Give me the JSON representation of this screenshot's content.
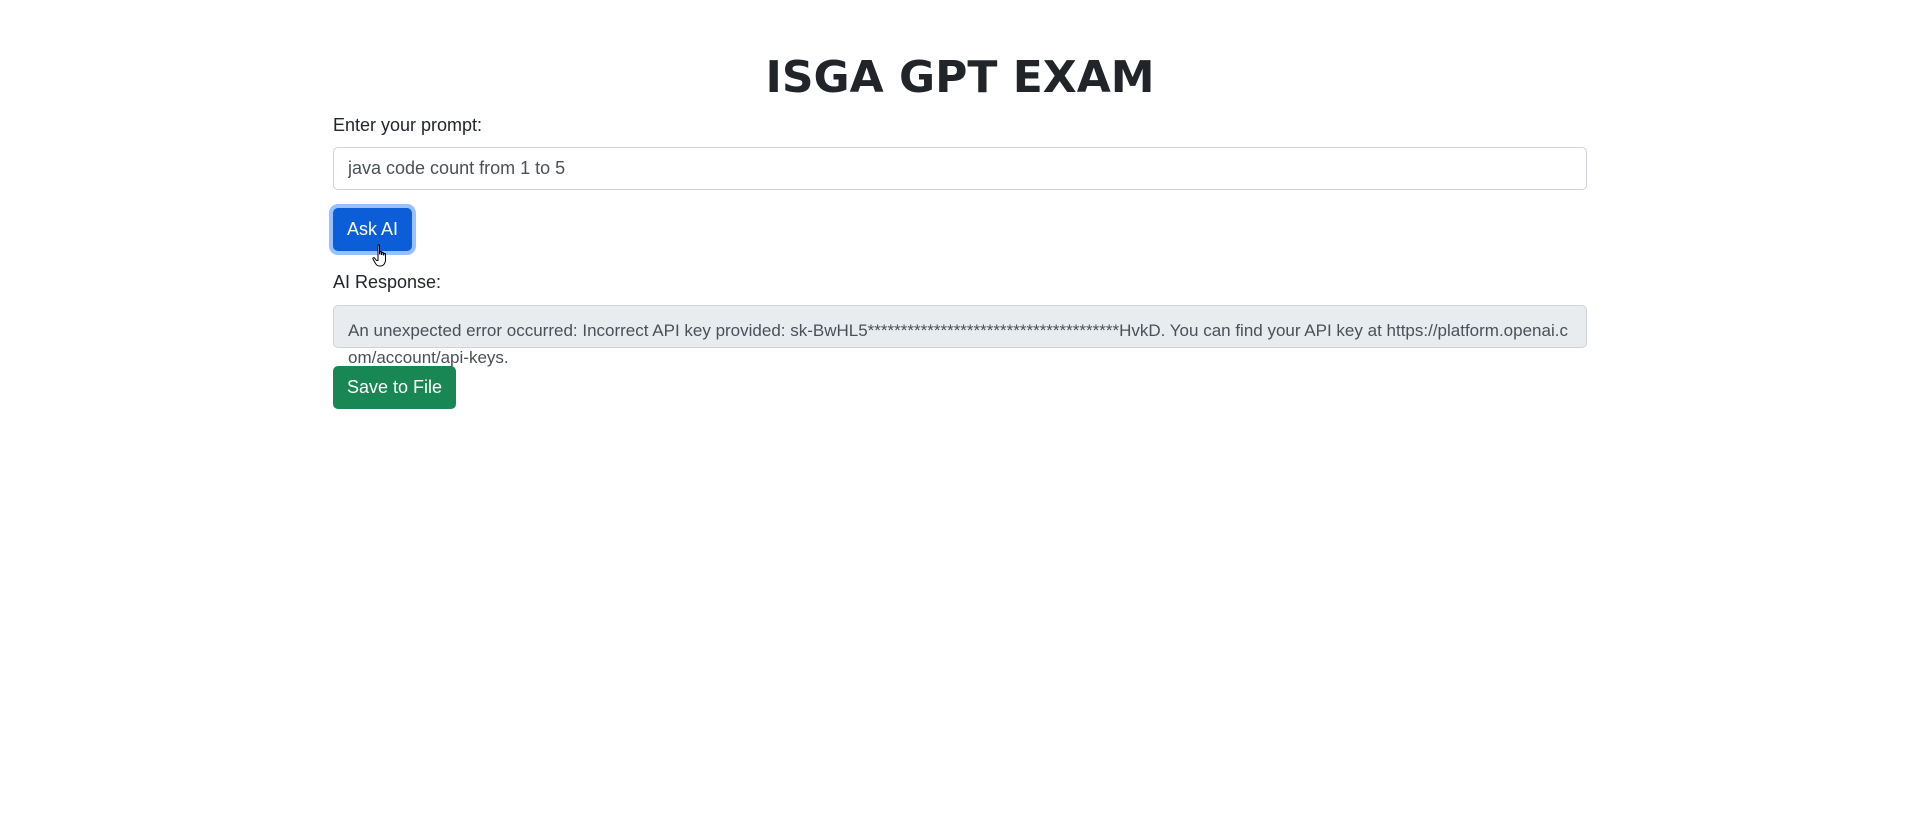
{
  "page": {
    "title": "ISGA GPT EXAM"
  },
  "prompt": {
    "label": "Enter your prompt:",
    "value": "java code count from 1 to 5"
  },
  "ask_button": {
    "label": "Ask AI",
    "color": "#0b5ed7"
  },
  "response": {
    "label": "AI Response:",
    "text": "An unexpected error occurred: Incorrect API key provided: sk-BwHL5**************************************HvkD. You can find your API key at https://platform.openai.com/account/api-keys."
  },
  "save_button": {
    "label": "Save to File",
    "color": "#198754"
  },
  "icons": {
    "cursor": "hand-pointer-icon"
  }
}
